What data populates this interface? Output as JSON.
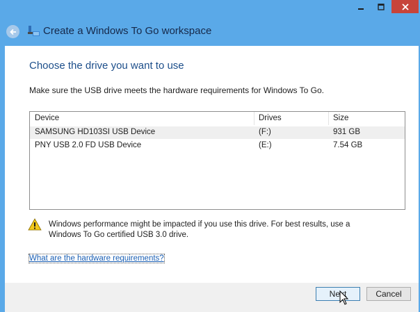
{
  "window": {
    "title": "Create a Windows To Go workspace",
    "controls": {
      "minimize": "minimize-icon",
      "maximize": "maximize-icon",
      "close": "close-icon"
    }
  },
  "page": {
    "heading": "Choose the drive you want to use",
    "instruction": "Make sure the USB drive meets the hardware requirements for Windows To Go."
  },
  "drive_list": {
    "columns": [
      "Device",
      "Drives",
      "Size"
    ],
    "rows": [
      {
        "device": "SAMSUNG HD103SI USB Device",
        "drive": "(F:)",
        "size": "931 GB",
        "selected": true
      },
      {
        "device": "PNY USB 2.0 FD USB Device",
        "drive": "(E:)",
        "size": "7.54 GB",
        "selected": false
      }
    ]
  },
  "warning": {
    "icon": "warning-triangle-icon",
    "text": "Windows performance might be impacted if you use this drive. For best results, use a Windows To Go certified USB 3.0 drive."
  },
  "link": {
    "text": "What are the hardware requirements?"
  },
  "buttons": {
    "next": "Next",
    "cancel": "Cancel"
  },
  "colors": {
    "titlebar": "#5aa9e8",
    "heading": "#1c4e8a",
    "close_button": "#c7443a",
    "link": "#1a5fb4"
  }
}
